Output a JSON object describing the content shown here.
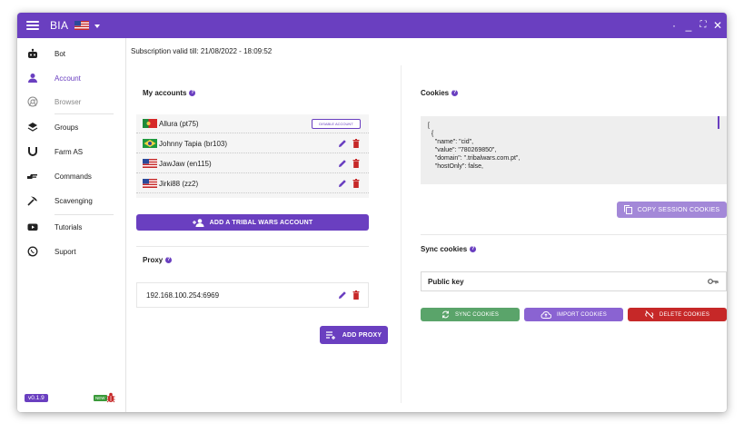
{
  "app": {
    "title": "BIA",
    "language_flag": "us-flag"
  },
  "window_controls": [
    "·",
    "_",
    "⛶",
    "✕"
  ],
  "sidebar": {
    "items": [
      {
        "label": "Bot",
        "icon": "robot-icon"
      },
      {
        "label": "Account",
        "icon": "person-icon"
      },
      {
        "label": "Browser",
        "icon": "chrome-icon"
      },
      {
        "label": "Groups",
        "icon": "layers-icon"
      },
      {
        "label": "Farm AS",
        "icon": "magnet-icon"
      },
      {
        "label": "Commands",
        "icon": "pointing-hand-icon"
      },
      {
        "label": "Scavenging",
        "icon": "pickaxe-icon"
      },
      {
        "label": "Tutorials",
        "icon": "youtube-icon"
      },
      {
        "label": "Suport",
        "icon": "whatsapp-icon"
      }
    ],
    "version": "v0.1.9",
    "new_badge": "NEW"
  },
  "subscription": "Subscription valid till: 21/08/2022 - 18:09:52",
  "accounts": {
    "title": "My accounts",
    "items": [
      {
        "name": "Allura (pt75)",
        "flag": "portugal-flag"
      },
      {
        "name": "Johnny Tapia (br103)",
        "flag": "brazil-flag"
      },
      {
        "name": "JawJaw (en115)",
        "flag": "us-flag"
      },
      {
        "name": "Jirki88 (zz2)",
        "flag": "us-flag"
      }
    ],
    "disable_label": "DISABLE ACCOUNT",
    "add_label": "ADD A TRIBAL WARS ACCOUNT"
  },
  "proxy": {
    "title": "Proxy",
    "value": "192.168.100.254:6969",
    "add_label": "ADD PROXY"
  },
  "cookies": {
    "title": "Cookies",
    "json_text": "[\n  {\n    \"name\": \"cid\",\n    \"value\": \"780269850\",\n    \"domain\": \".tribalwars.com.pt\",\n    \"hostOnly\": false,",
    "copy_label": "COPY SESSION COOKIES"
  },
  "sync": {
    "title": "Sync cookies",
    "public_key_label": "Public key",
    "sync_label": "SYNC COOKIES",
    "import_label": "IMPORT COOKIES",
    "delete_label": "DELETE COOKIES"
  },
  "colors": {
    "primary": "#6a3fc0",
    "danger": "#c62828",
    "success": "#5aa46a"
  }
}
